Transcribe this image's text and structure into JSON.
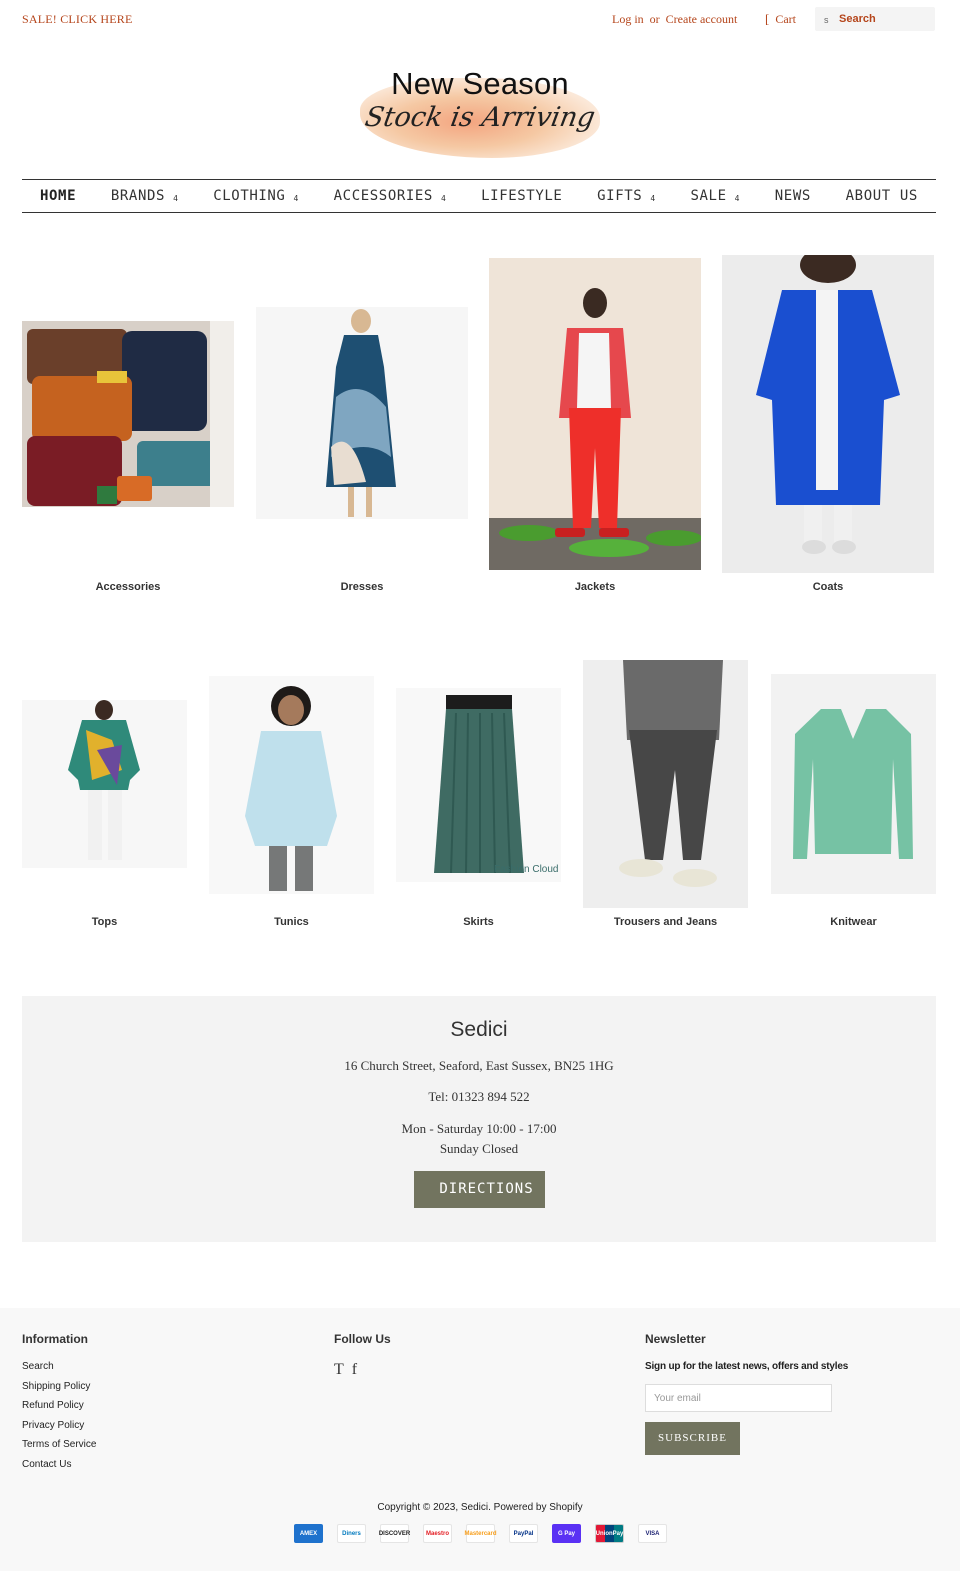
{
  "topbar": {
    "sale_link": "SALE! CLICK HERE",
    "login": "Log in",
    "or": "or",
    "create_account": "Create account",
    "cart": "Cart",
    "search_placeholder": "Search"
  },
  "logo": {
    "line1": "New Season",
    "line2": "Stock is Arriving"
  },
  "nav": [
    {
      "label": "HOME",
      "dropdown": false
    },
    {
      "label": "BRANDS",
      "dropdown": true
    },
    {
      "label": "CLOTHING",
      "dropdown": true
    },
    {
      "label": "ACCESSORIES",
      "dropdown": true
    },
    {
      "label": "LIFESTYLE",
      "dropdown": false
    },
    {
      "label": "GIFTS",
      "dropdown": true
    },
    {
      "label": "SALE",
      "dropdown": true
    },
    {
      "label": "NEWS",
      "dropdown": false
    },
    {
      "label": "ABOUT US",
      "dropdown": false
    }
  ],
  "nav_caret": "4",
  "collections_row1": [
    {
      "label": "Accessories"
    },
    {
      "label": "Dresses"
    },
    {
      "label": "Jackets"
    },
    {
      "label": "Coats"
    }
  ],
  "collections_row2": [
    {
      "label": "Tops"
    },
    {
      "label": "Tunics"
    },
    {
      "label": "Skirts",
      "watermark": "Fashion Cloud"
    },
    {
      "label": "Trousers and Jeans"
    },
    {
      "label": "Knitwear"
    }
  ],
  "store": {
    "name": "Sedici",
    "address": "16 Church Street, Seaford, East Sussex, BN25 1HG",
    "tel": "Tel: 01323 894 522",
    "hours1": "Mon - Saturday 10:00 - 17:00",
    "hours2": "Sunday Closed",
    "button": "DIRECTIONS"
  },
  "footer": {
    "info_title": "Information",
    "info_links": [
      "Search",
      "Shipping Policy",
      "Refund Policy",
      "Privacy Policy",
      "Terms of Service",
      "Contact Us"
    ],
    "follow_title": "Follow Us",
    "social": [
      "T",
      "f"
    ],
    "newsletter_title": "Newsletter",
    "newsletter_text": "Sign up for the latest news, offers and styles",
    "email_placeholder": "Your email",
    "subscribe": "SUBSCRIBE",
    "copyright": "Copyright © 2023, Sedici. Powered by Shopify",
    "payments": [
      "AMEX",
      "Diners",
      "DISCOVER",
      "Maestro",
      "Mastercard",
      "PayPal",
      "G Pay",
      "UnionPay",
      "VISA"
    ]
  },
  "colors": {
    "accent": "#b5451b",
    "button": "#72745f",
    "panel": "#f3f3f3"
  }
}
